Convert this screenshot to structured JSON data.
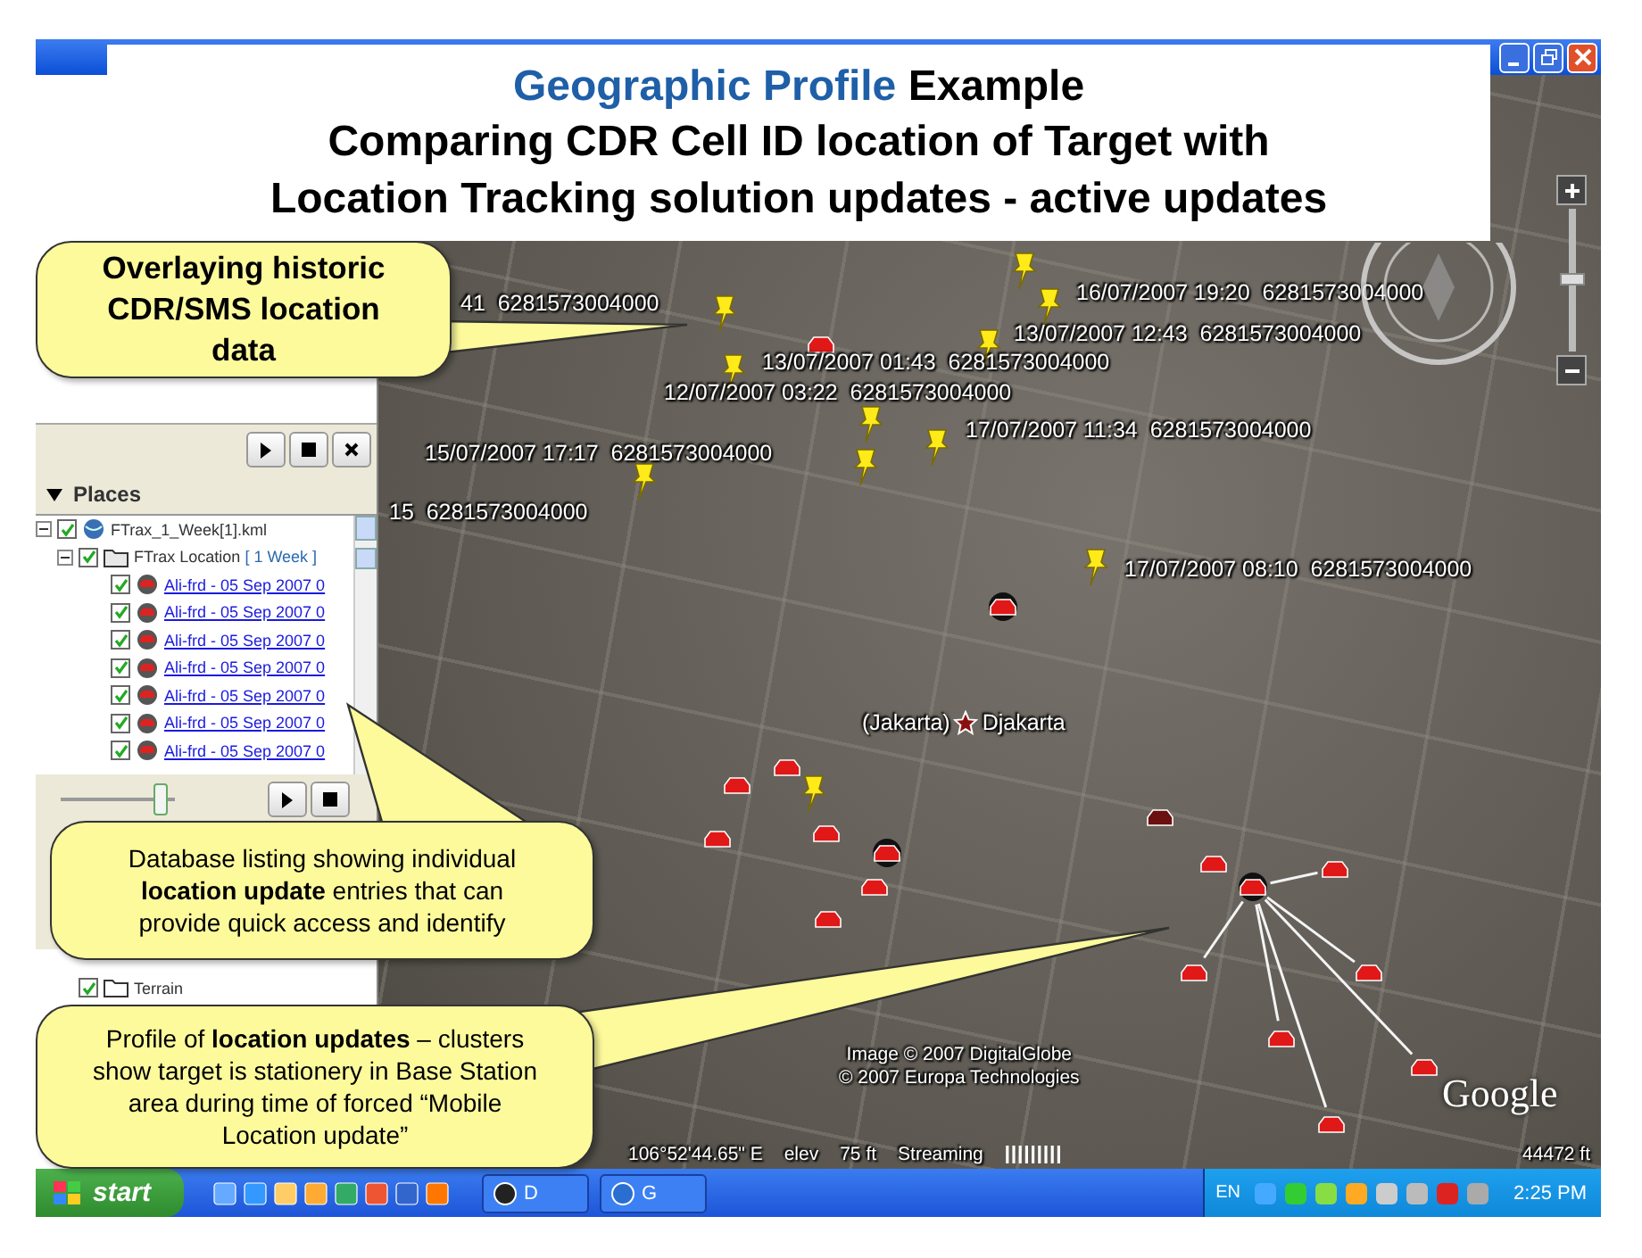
{
  "title": {
    "highlight": "Geographic Profile",
    "rest": "Example",
    "lines": [
      "Comparing CDR Cell ID location of Target with",
      "Location Tracking solution updates - active updates"
    ]
  },
  "places": {
    "heading": "Places",
    "expanded": true,
    "tree": [
      {
        "label": "FTrax_1_Week[1].kml",
        "checked": true,
        "expanded": true,
        "children": [
          {
            "label": "FTrax Location",
            "suffix": "[ 1 Week ]",
            "checked": true,
            "expanded": true,
            "children": [
              {
                "label": "Ali-frd - 05 Sep 2007 0",
                "checked": true
              },
              {
                "label": "Ali-frd - 05 Sep 2007 0",
                "checked": true
              },
              {
                "label": "Ali-frd - 05 Sep 2007 0",
                "checked": true
              },
              {
                "label": "Ali-frd - 05 Sep 2007 0",
                "checked": true
              },
              {
                "label": "Ali-frd - 05 Sep 2007 0",
                "checked": true
              },
              {
                "label": "Ali-frd - 05 Sep 2007 0",
                "checked": true
              },
              {
                "label": "Ali-frd - 05 Sep 2007 0",
                "checked": true
              }
            ]
          }
        ]
      }
    ]
  },
  "tour_slider": {
    "level": 0.93
  },
  "layers": {
    "items": [
      {
        "label": "Terrain",
        "checked": true
      }
    ]
  },
  "map": {
    "labels": [
      "41  6281573004000",
      "16/07/2007 19:20  6281573004000",
      "13/07/2007 12:43  6281573004000",
      "13/07/2007 01:43  6281573004000",
      "12/07/2007 03:22  6281573004000",
      "17/07/2007 11:34  6281573004000",
      "15/07/2007 17:17  6281573004000",
      "15  6281573004000",
      "17/07/2007 08:10  6281573004000"
    ],
    "place_names": [
      "(Jakarta)",
      "Djakarta"
    ],
    "attribution": [
      "Image © 2007 DigitalGlobe",
      "© 2007 Europa Technologies"
    ],
    "logo": "Google",
    "zoom": {
      "level": 0.5
    },
    "status": {
      "coordinates": "106°52'44.65\" E",
      "elev_label": "elev",
      "elev_value": "75 ft",
      "streaming": "Streaming",
      "eye_alt": "44472 ft"
    }
  },
  "callouts": [
    {
      "text": "Overlaying historic CDR/SMS location data"
    },
    {
      "text": "Database listing showing individual **location update** entries that can provide quick access and identify"
    },
    {
      "text": "Profile of **location updates** – clusters show target is stationery in Base Station area during time of forced “Mobile Location update”"
    }
  ],
  "taskbar": {
    "start": "start",
    "tasks": [
      {
        "label": "D"
      },
      {
        "label": "G"
      }
    ],
    "language": "EN",
    "clock": "2:25 PM"
  }
}
